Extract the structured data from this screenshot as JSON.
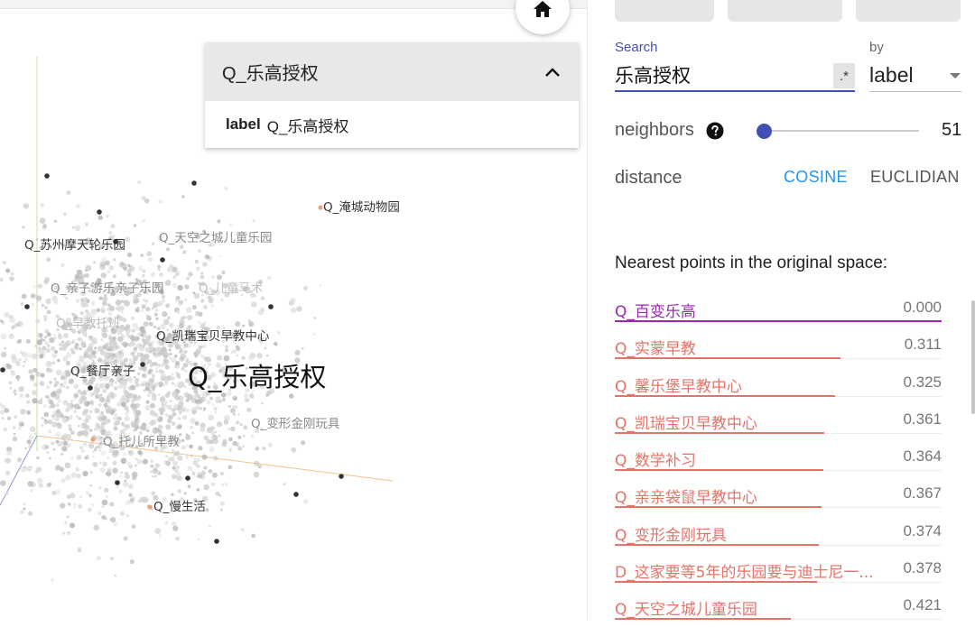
{
  "search_card": {
    "title": "Q_乐高授权",
    "row_key": "label",
    "row_value": "Q_乐高授权"
  },
  "viz": {
    "labels": [
      {
        "text": "Q_淹城动物园",
        "style": "normal"
      },
      {
        "text": "Q_苏州摩天轮乐园",
        "style": "normal"
      },
      {
        "text": "Q_天空之城儿童乐园",
        "style": "faded"
      },
      {
        "text": "Q_亲子游乐亲子乐园",
        "style": "faded"
      },
      {
        "text": "Q_儿童马术",
        "style": "very-faded"
      },
      {
        "text": "Q_早教托班",
        "style": "very-faded"
      },
      {
        "text": "Q_凯瑞宝贝早教中心",
        "style": "normal"
      },
      {
        "text": "Q_餐厅亲子",
        "style": "normal"
      },
      {
        "text": "Q_乐高授权",
        "style": "big"
      },
      {
        "text": "Q_变形金刚玩具",
        "style": "faded"
      },
      {
        "text": "Q_托儿所早教",
        "style": "faded"
      },
      {
        "text": "Q_慢生活",
        "style": "normal"
      }
    ]
  },
  "panel": {
    "search_label": "Search",
    "search_value": "乐高授权",
    "regex_label": ".*",
    "by_label": "by",
    "by_value": "label",
    "neighbors_label": "neighbors",
    "neighbors_value": 51,
    "neighbors_max": 100,
    "distance_label": "distance",
    "cosine_label": "COSINE",
    "euclidean_label": "EUCLIDIAN",
    "nearest_title": "Nearest points in the original space:",
    "nearest": [
      {
        "name": "Q_百变乐高",
        "value": "0.000"
      },
      {
        "name": "Q_实蒙早教",
        "value": "0.311"
      },
      {
        "name": "Q_馨乐堡早教中心",
        "value": "0.325"
      },
      {
        "name": "Q_凯瑞宝贝早教中心",
        "value": "0.361"
      },
      {
        "name": "Q_数学补习",
        "value": "0.364"
      },
      {
        "name": "Q_亲亲袋鼠早教中心",
        "value": "0.367"
      },
      {
        "name": "Q_变形金刚玩具",
        "value": "0.374"
      },
      {
        "name": "D_这家要等5年的乐园要与迪士尼一...",
        "value": "0.378"
      },
      {
        "name": "Q_天空之城儿童乐园",
        "value": "0.421"
      }
    ]
  },
  "colors": {
    "accent": "#3f51b5",
    "active_toggle": "#2196f3",
    "nearest_first": "#9c27b0",
    "nearest_rest": "#e57368"
  },
  "icons": {
    "home": "home-icon",
    "collapse": "chevron-up-icon",
    "help": "help-circle-icon",
    "dropdown": "caret-down-icon"
  }
}
